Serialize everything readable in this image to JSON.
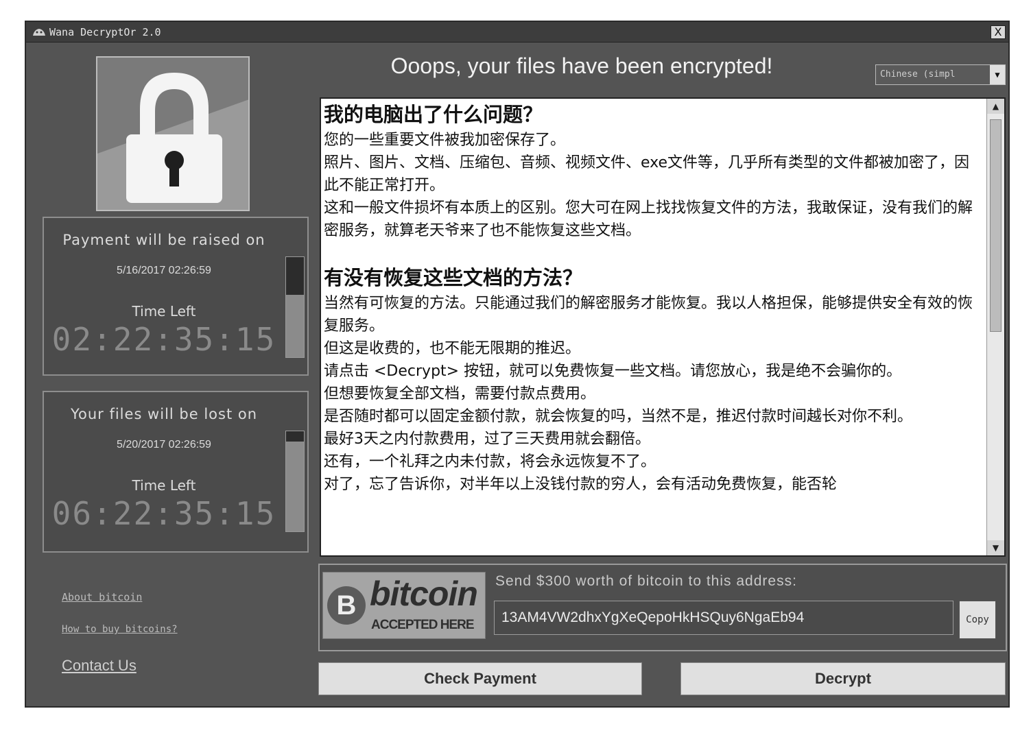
{
  "window": {
    "title": "Wana DecryptOr 2.0",
    "close_label": "X"
  },
  "header": {
    "headline": "Ooops, your files have been encrypted!",
    "language": "Chinese (simpl"
  },
  "timers": [
    {
      "heading": "Payment will be raised on",
      "date": "5/16/2017 02:26:59",
      "time_left_label": "Time Left",
      "countdown": "02:22:35:15",
      "progress": 0.62
    },
    {
      "heading": "Your files will be lost on",
      "date": "5/20/2017 02:26:59",
      "time_left_label": "Time Left",
      "countdown": "06:22:35:15",
      "progress": 0.9
    }
  ],
  "links": {
    "about_bitcoin": "About bitcoin",
    "how_to_buy": "How to buy bitcoins?",
    "contact": "Contact Us"
  },
  "message": {
    "h1": "我的电脑出了什么问题？",
    "p1": "您的一些重要文件被我加密保存了。",
    "p2": "照片、图片、文档、压缩包、音频、视频文件、exe文件等，几乎所有类型的文件都被加密了，因此不能正常打开。",
    "p3": "这和一般文件损坏有本质上的区别。您大可在网上找找恢复文件的方法，我敢保证，没有我们的解密服务，就算老天爷来了也不能恢复这些文档。",
    "h2": "有没有恢复这些文档的方法？",
    "p4": "当然有可恢复的方法。只能通过我们的解密服务才能恢复。我以人格担保，能够提供安全有效的恢复服务。",
    "p5": "但这是收费的，也不能无限期的推迟。",
    "p6": "请点击 <Decrypt> 按钮，就可以免费恢复一些文档。请您放心，我是绝不会骗你的。",
    "p7": "但想要恢复全部文档，需要付款点费用。",
    "p8": "是否随时都可以固定金额付款，就会恢复的吗，当然不是，推迟付款时间越长对你不利。",
    "p9": "最好3天之内付款费用，过了三天费用就会翻倍。",
    "p10": "还有，一个礼拜之内未付款，将会永远恢复不了。",
    "p11": "对了，忘了告诉你，对半年以上没钱付款的穷人，会有活动免费恢复，能否轮"
  },
  "bitcoin": {
    "logo_symbol": "B",
    "logo_word": "bitcoin",
    "logo_sub": "ACCEPTED HERE",
    "send_label": "Send $300 worth of bitcoin to this address:",
    "address": "13AM4VW2dhxYgXeQepoHkHSQuy6NgaEb94",
    "copy_label": "Copy"
  },
  "buttons": {
    "check_payment": "Check Payment",
    "decrypt": "Decrypt"
  },
  "icons": [
    "app-icon",
    "close-icon",
    "padlock-icon",
    "dropdown-arrow-icon",
    "scroll-up-icon",
    "scroll-down-icon",
    "bitcoin-logo-icon"
  ]
}
